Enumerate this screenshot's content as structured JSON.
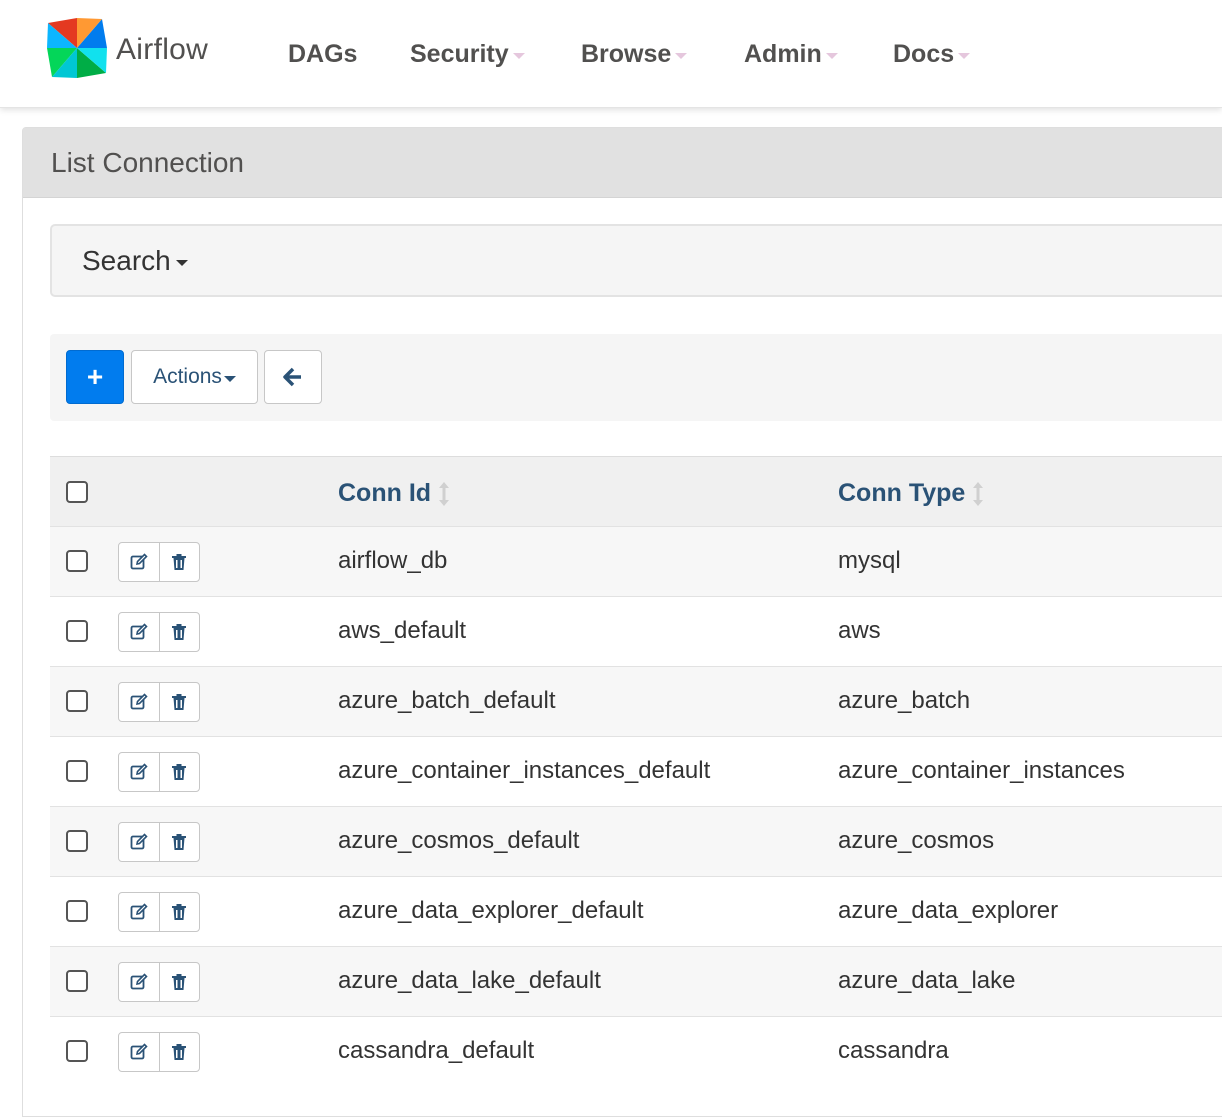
{
  "brand": {
    "name": "Airflow"
  },
  "nav": {
    "items": [
      {
        "label": "DAGs",
        "dropdown": false
      },
      {
        "label": "Security",
        "dropdown": true
      },
      {
        "label": "Browse",
        "dropdown": true
      },
      {
        "label": "Admin",
        "dropdown": true
      },
      {
        "label": "Docs",
        "dropdown": true
      }
    ]
  },
  "page": {
    "title": "List Connection"
  },
  "search": {
    "label": "Search"
  },
  "toolbar": {
    "add_label": "+",
    "actions_label": "Actions"
  },
  "table": {
    "columns": [
      {
        "label": "Conn Id"
      },
      {
        "label": "Conn Type"
      }
    ],
    "rows": [
      {
        "conn_id": "airflow_db",
        "conn_type": "mysql"
      },
      {
        "conn_id": "aws_default",
        "conn_type": "aws"
      },
      {
        "conn_id": "azure_batch_default",
        "conn_type": "azure_batch"
      },
      {
        "conn_id": "azure_container_instances_default",
        "conn_type": "azure_container_instances"
      },
      {
        "conn_id": "azure_cosmos_default",
        "conn_type": "azure_cosmos"
      },
      {
        "conn_id": "azure_data_explorer_default",
        "conn_type": "azure_data_explorer"
      },
      {
        "conn_id": "azure_data_lake_default",
        "conn_type": "azure_data_lake"
      },
      {
        "conn_id": "cassandra_default",
        "conn_type": "cassandra"
      }
    ]
  },
  "colors": {
    "primary": "#017cee",
    "link": "#2a5276",
    "nav_text": "#51504f",
    "heading_bg": "#e1e1e1"
  }
}
